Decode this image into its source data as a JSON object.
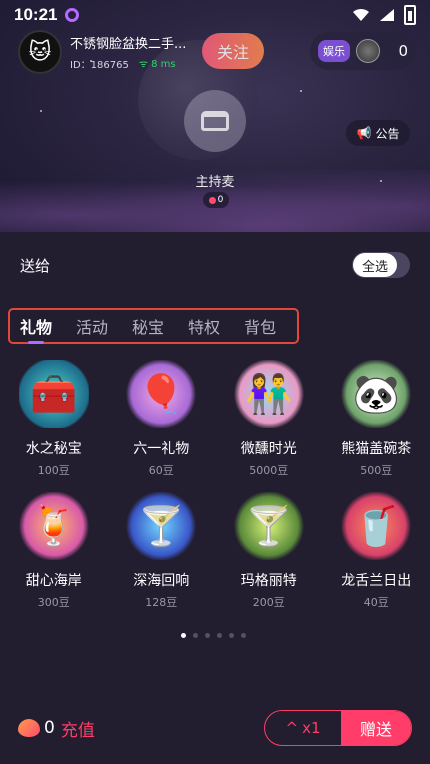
{
  "status_bar": {
    "time": "10:21"
  },
  "host": {
    "name": "不锈钢脸盆换二手...",
    "id": "ID：186765",
    "ping": "8 ms",
    "follow_label": "关注"
  },
  "room": {
    "category": "娱乐",
    "online_count": "0",
    "notice_label": "公告",
    "seat_label": "主持麦",
    "seat_hearts": "0"
  },
  "panel": {
    "send_to_label": "送给",
    "select_all_label": "全选",
    "tabs": [
      {
        "label": "礼物",
        "active": true
      },
      {
        "label": "活动",
        "active": false
      },
      {
        "label": "秘宝",
        "active": false
      },
      {
        "label": "特权",
        "active": false
      },
      {
        "label": "背包",
        "active": false
      }
    ],
    "gifts": [
      {
        "name": "水之秘宝",
        "price": "100豆",
        "icon": "treasure-chest-icon",
        "glyph": "🧰"
      },
      {
        "name": "六一礼物",
        "price": "60豆",
        "icon": "balloon-61-icon",
        "glyph": "🎈"
      },
      {
        "name": "微醺时光",
        "price": "5000豆",
        "icon": "couple-beach-icon",
        "glyph": "👫"
      },
      {
        "name": "熊猫盖碗茶",
        "price": "500豆",
        "icon": "panda-tea-icon",
        "glyph": "🐼"
      },
      {
        "name": "甜心海岸",
        "price": "300豆",
        "icon": "cocktail-sweet-icon",
        "glyph": "🍹"
      },
      {
        "name": "深海回响",
        "price": "128豆",
        "icon": "cocktail-blue-icon",
        "glyph": "🍸"
      },
      {
        "name": "玛格丽特",
        "price": "200豆",
        "icon": "margarita-icon",
        "glyph": "🍸"
      },
      {
        "name": "龙舌兰日出",
        "price": "40豆",
        "icon": "tequila-sunrise-icon",
        "glyph": "🥤"
      }
    ],
    "page_dots": 6,
    "active_dot": 0
  },
  "bottom": {
    "balance": "0",
    "recharge_label": "充值",
    "quantity_label": "x1",
    "send_label": "赠送"
  },
  "colors": {
    "accent": "#ff3d68",
    "tab_underline": "#b469ff",
    "highlight_box": "#e2473b"
  }
}
